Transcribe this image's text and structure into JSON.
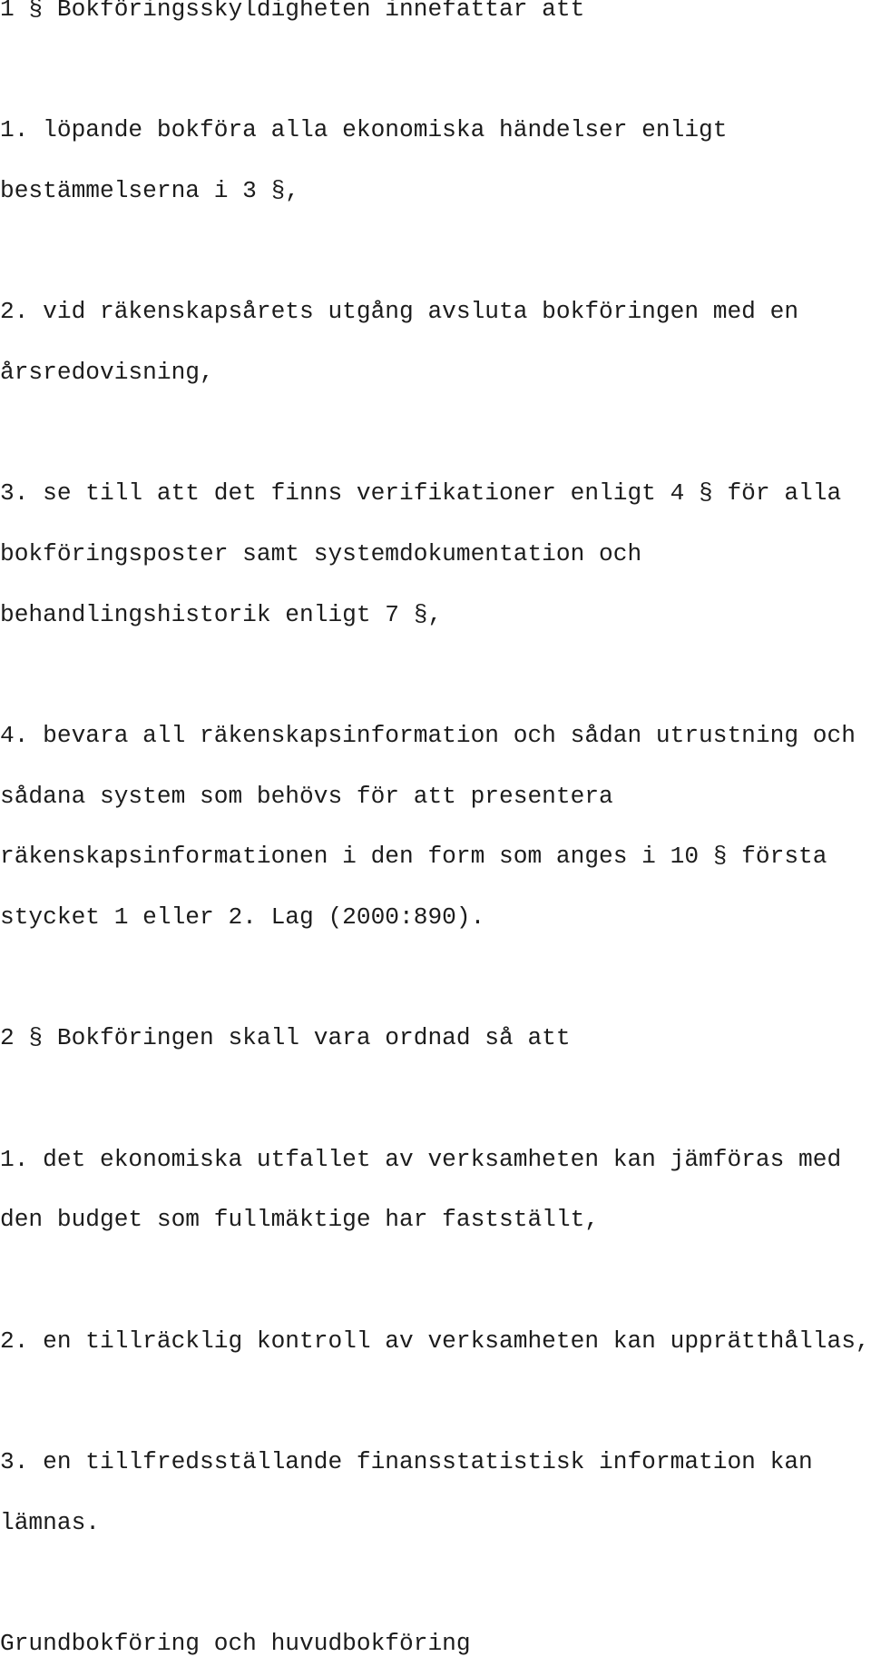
{
  "document": {
    "section_1": {
      "heading": "1 § Bokföringsskyldigheten innefattar att",
      "items": [
        {
          "lines": [
            "1. löpande bokföra alla ekonomiska händelser enligt",
            "bestämmelserna i 3 §,"
          ]
        },
        {
          "lines": [
            "2. vid räkenskapsårets utgång avsluta bokföringen med en",
            "årsredovisning,"
          ]
        },
        {
          "lines": [
            "3. se till att det finns verifikationer enligt 4 § för alla",
            "bokföringsposter samt systemdokumentation och",
            "behandlingshistorik enligt 7 §,"
          ]
        },
        {
          "lines": [
            "4. bevara all räkenskapsinformation och sådan utrustning och",
            "sådana system som behövs för att presentera",
            "räkenskapsinformationen i den form som anges i 10 § första",
            "stycket 1 eller 2. Lag (2000:890)."
          ]
        }
      ]
    },
    "section_2": {
      "heading": "2 § Bokföringen skall vara ordnad så att",
      "items": [
        {
          "lines": [
            "1. det ekonomiska utfallet av verksamheten kan jämföras med",
            "den budget som fullmäktige har fastställt,"
          ]
        },
        {
          "lines": [
            "2. en tillräcklig kontroll av verksamheten kan upprätthållas,"
          ]
        },
        {
          "lines": [
            "3. en tillfredsställande finansstatistisk information kan",
            "lämnas."
          ]
        }
      ]
    },
    "section_3": {
      "heading": "Grundbokföring och huvudbokföring"
    }
  }
}
